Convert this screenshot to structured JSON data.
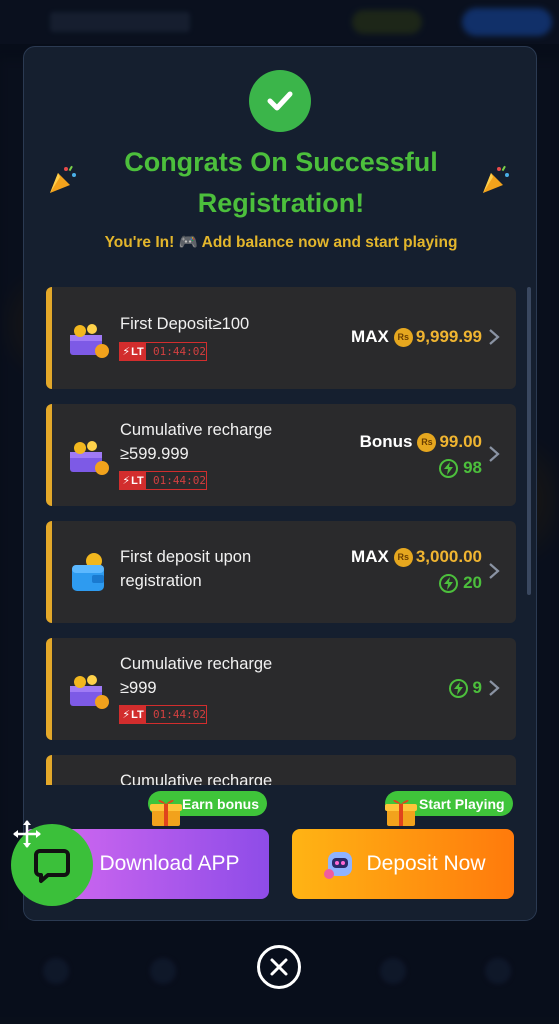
{
  "modal": {
    "title": "Congrats On Successful Registration!",
    "subtitle": "You're In! 🎮 Add balance now and start playing"
  },
  "offers": [
    {
      "name": "First Deposit≥100",
      "limited_badge": "LT",
      "timer": "01:44:02",
      "reward_label": "MAX",
      "currency_icon": "Rs",
      "amount": "9,999.99",
      "bonus_points": null,
      "icon": "treasure-box-icon"
    },
    {
      "name": "Cumulative recharge ≥599.999",
      "limited_badge": "LT",
      "timer": "01:44:02",
      "reward_label": "Bonus",
      "currency_icon": "Rs",
      "amount": "99.00",
      "bonus_points": "98",
      "icon": "treasure-box-icon"
    },
    {
      "name": "First deposit upon registration",
      "limited_badge": null,
      "timer": null,
      "reward_label": "MAX",
      "currency_icon": "Rs",
      "amount": "3,000.00",
      "bonus_points": "20",
      "icon": "wallet-icon"
    },
    {
      "name": "Cumulative recharge ≥999",
      "limited_badge": "LT",
      "timer": "01:44:02",
      "reward_label": null,
      "currency_icon": null,
      "amount": null,
      "bonus_points": "9",
      "icon": "treasure-box-icon"
    },
    {
      "name": "Cumulative recharge",
      "limited_badge": null,
      "timer": null,
      "reward_label": null,
      "currency_icon": null,
      "amount": null,
      "bonus_points": null,
      "icon": null
    }
  ],
  "actions": {
    "download_tag": "Earn bonus",
    "download_label": "Download APP",
    "deposit_tag": "Start Playing",
    "deposit_label": "Deposit Now"
  },
  "colors": {
    "accent_green": "#4cbf3c",
    "accent_gold": "#f0b531",
    "download_gradient": [
      "#d86bf0",
      "#8e4ce8"
    ],
    "deposit_gradient": [
      "#ffb414",
      "#ff7a0c"
    ]
  }
}
